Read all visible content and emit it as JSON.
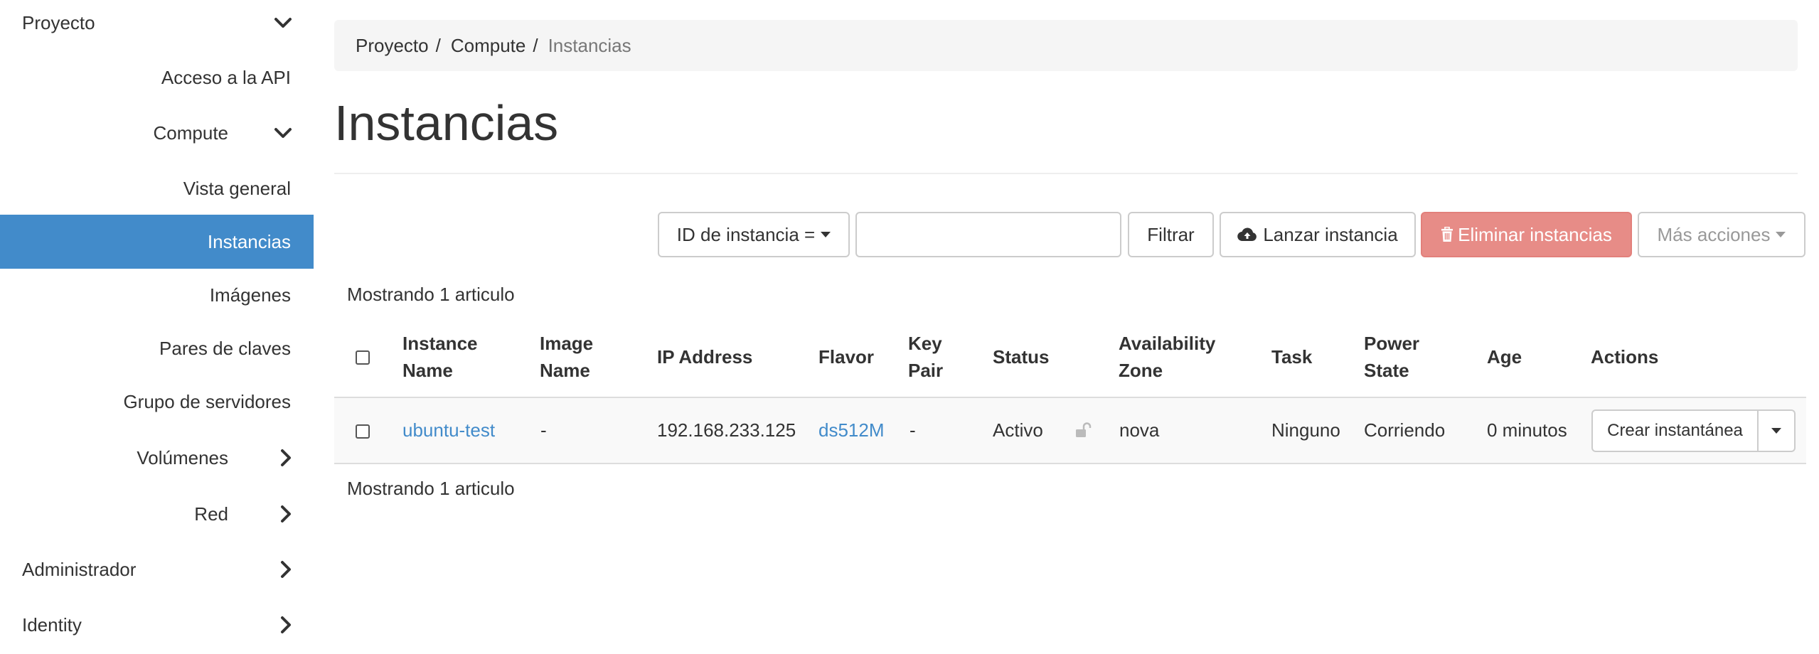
{
  "sidebar": {
    "proyecto": "Proyecto",
    "acceso_api": "Acceso a la API",
    "compute": "Compute",
    "vista_general": "Vista general",
    "instancias": "Instancias",
    "imagenes": "Imágenes",
    "pares_claves": "Pares de claves",
    "grupo_servidores": "Grupo de servidores",
    "volumenes": "Volúmenes",
    "red": "Red",
    "administrador": "Administrador",
    "identity": "Identity"
  },
  "breadcrumb": {
    "items": [
      "Proyecto",
      "Compute"
    ],
    "separator": "/",
    "current": "Instancias"
  },
  "page": {
    "title": "Instancias"
  },
  "toolbar": {
    "filter_field": "ID de instancia =",
    "filter_value": "",
    "filter_button": "Filtrar",
    "launch_button": "Lanzar instancia",
    "delete_button": "Eliminar instancias",
    "more_actions": "Más acciones"
  },
  "table": {
    "count_top": "Mostrando 1 articulo",
    "count_bottom": "Mostrando 1 articulo",
    "headers": {
      "instance_name": [
        "Instance",
        "Name"
      ],
      "image_name": [
        "Image",
        "Name"
      ],
      "ip_address": "IP Address",
      "flavor": "Flavor",
      "key_pair": [
        "Key",
        "Pair"
      ],
      "status": "Status",
      "availability_zone": [
        "Availability",
        "Zone"
      ],
      "task": "Task",
      "power_state": [
        "Power",
        "State"
      ],
      "age": "Age",
      "actions": "Actions"
    },
    "rows": [
      {
        "instance_name": "ubuntu-test",
        "image_name": "-",
        "ip_address": "192.168.233.125",
        "flavor": "ds512M",
        "key_pair": "-",
        "status": "Activo",
        "availability_zone": "nova",
        "task": "Ninguno",
        "power_state": "Corriendo",
        "age": "0 minutos",
        "action": "Crear instantánea"
      }
    ]
  },
  "colors": {
    "accent": "#428bca",
    "danger_button": "#e78c87",
    "breadcrumb_bg": "#f5f5f5"
  }
}
